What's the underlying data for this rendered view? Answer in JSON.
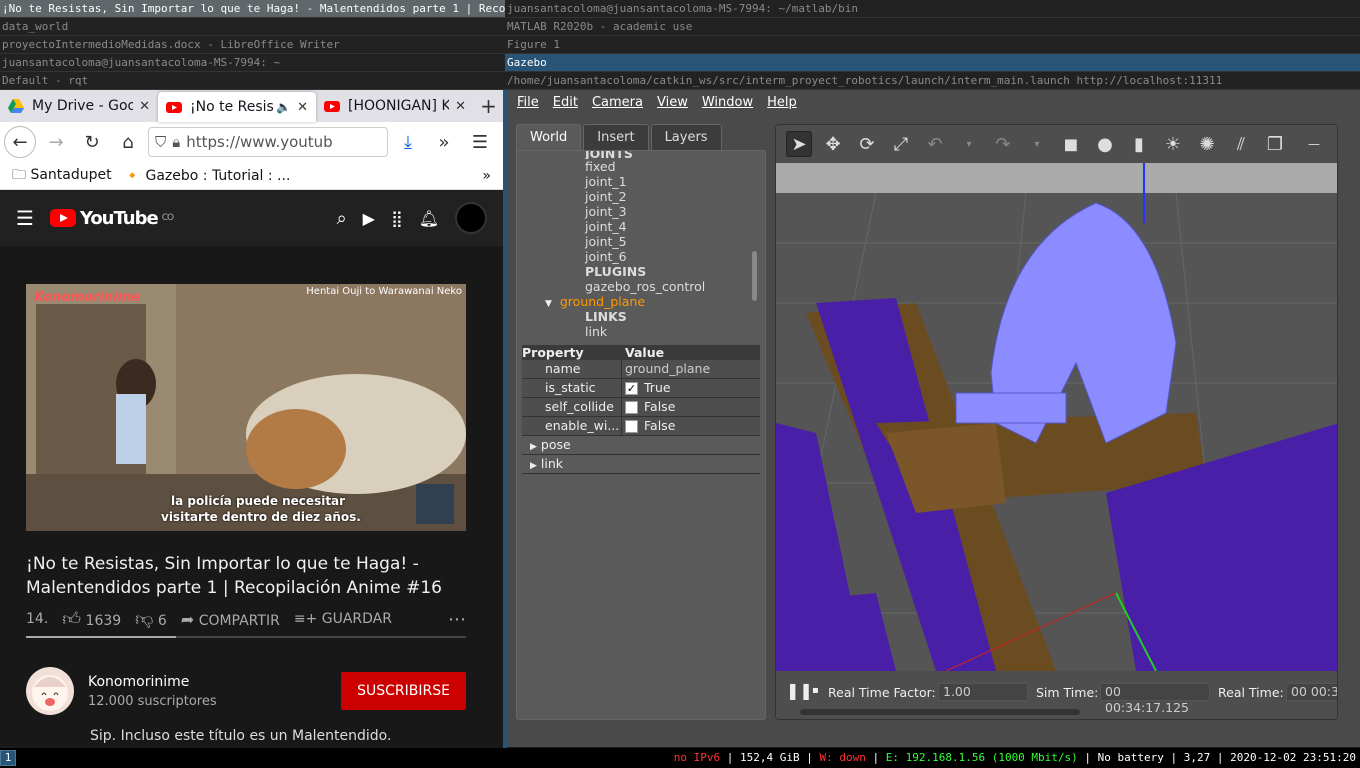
{
  "titlebars": {
    "left": [
      "¡No te Resistas, Sin Importar lo que te Haga! - Malentendidos parte 1 | Recopilaci…",
      "data_world",
      "proyectoIntermedioMedidas.docx - LibreOffice Writer",
      "juansantacoloma@juansantacoloma-MS-7994: ~",
      "Default - rqt"
    ],
    "right": [
      "juansantacoloma@juansantacoloma-MS-7994: ~/matlab/bin",
      "MATLAB R2020b - academic use",
      "Figure 1",
      "Gazebo",
      "/home/juansantacoloma/catkin_ws/src/interm_proyect_robotics/launch/interm_main.launch http://localhost:11311"
    ]
  },
  "firefox": {
    "tabs": [
      {
        "title": "My Drive - Goo",
        "icon": "google-drive-icon"
      },
      {
        "title": "¡No te Resis",
        "icon": "youtube-icon"
      },
      {
        "title": "[HOONIGAN] K",
        "icon": "youtube-icon"
      }
    ],
    "url": "https://www.youtub",
    "bookmarks": [
      "Santadupet",
      "Gazebo : Tutorial : ..."
    ]
  },
  "youtube": {
    "logo": "YouTube",
    "region": "CO",
    "video_overlay_channel": "Konomorinime",
    "video_overlay_title": "Hentai Ouji to Warawanai Neko",
    "subtitle_line1": "la policía puede necesitar",
    "subtitle_line2": "visitarte dentro de diez años.",
    "title": "¡No te Resistas, Sin Importar lo que te Haga! - Malentendidos parte 1 | Recopilación Anime #16",
    "views": "14.",
    "likes": "1639",
    "dislikes": "6",
    "share": "COMPARTIR",
    "save": "GUARDAR",
    "channel": "Konomorinime",
    "subscribers": "12.000 suscriptores",
    "subscribe": "SUSCRIBIRSE",
    "description": "Sip. Incluso este título es un Malentendido."
  },
  "gazebo": {
    "menu": [
      "File",
      "Edit",
      "Camera",
      "View",
      "Window",
      "Help"
    ],
    "panel_tabs": [
      "World",
      "Insert",
      "Layers"
    ],
    "tree": {
      "joints_header": "JOINTS",
      "joints": [
        "fixed",
        "joint_1",
        "joint_2",
        "joint_3",
        "joint_4",
        "joint_5",
        "joint_6"
      ],
      "plugins_header": "PLUGINS",
      "plugin": "gazebo_ros_control",
      "model": "ground_plane",
      "links_header": "LINKS",
      "link": "link"
    },
    "props": {
      "header_property": "Property",
      "header_value": "Value",
      "rows": [
        {
          "name": "name",
          "value": "ground_plane"
        },
        {
          "name": "is_static",
          "value": "True",
          "checked": true
        },
        {
          "name": "self_collide",
          "value": "False",
          "checked": false
        },
        {
          "name": "enable_wi...",
          "value": "False",
          "checked": false
        }
      ],
      "pose": "pose",
      "link": "link"
    },
    "sim": {
      "rtf_label": "Real Time Factor:",
      "rtf": "1.00",
      "sim_time_label": "Sim Time:",
      "sim_time": "00 00:34:17.125",
      "real_time_label": "Real Time:",
      "real_time": "00 00:3"
    }
  },
  "status": {
    "workspace": "1",
    "ipv6": "no IPv6",
    "disk": "152,4 GiB",
    "wifi": "W: down",
    "eth": "E: 192.168.1.56 (1000 Mbit/s)",
    "battery": "No battery",
    "load": "3,27",
    "datetime": "2020-12-02 23:51:20"
  }
}
